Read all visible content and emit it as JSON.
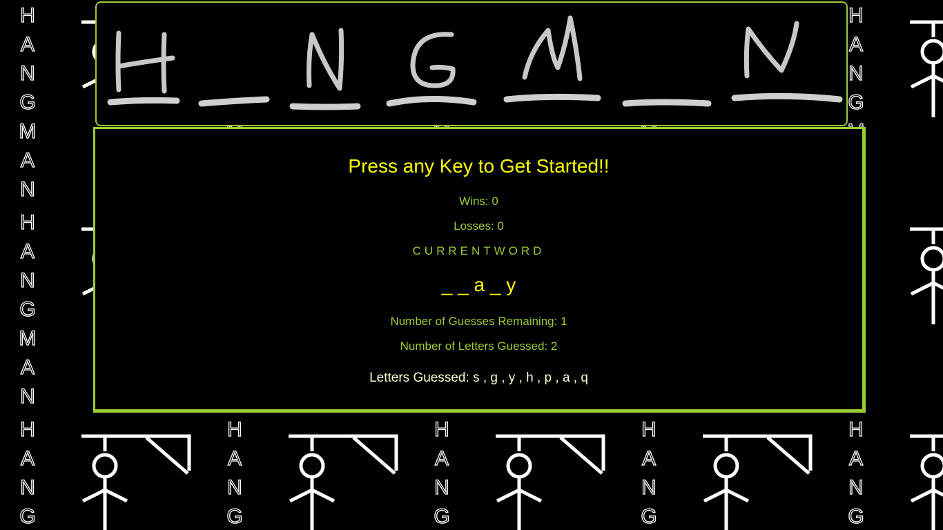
{
  "background": {
    "tile_letters": [
      "H",
      "A",
      "N",
      "G",
      "M",
      "A",
      "N"
    ],
    "colors": {
      "line": "#ffffff",
      "background": "#000000"
    },
    "figure": "stick-figure-gallows"
  },
  "banner": {
    "title_letters": [
      "H",
      "_",
      "N",
      "G",
      "M",
      "_",
      "N"
    ],
    "border_color": "#9acd32"
  },
  "game": {
    "prompt": "Press any Key to Get Started!!",
    "wins_label": "Wins:",
    "wins": 0,
    "losses_label": "Losses:",
    "losses": 0,
    "current_word_label": "CURRENTWORD",
    "current_word": "_ _ a _ y",
    "remaining_label": "Number of Guesses Remaining:",
    "remaining": 1,
    "guessed_count_label": "Number of Letters Guessed:",
    "guessed_count": 2,
    "letters_guessed_label": "Letters Guessed:",
    "letters_guessed": "s , g , y , h , p , a , q",
    "colors": {
      "accent_yellow": "#ffff00",
      "accent_green": "#9acd32",
      "letters": "#ffffcc"
    }
  }
}
